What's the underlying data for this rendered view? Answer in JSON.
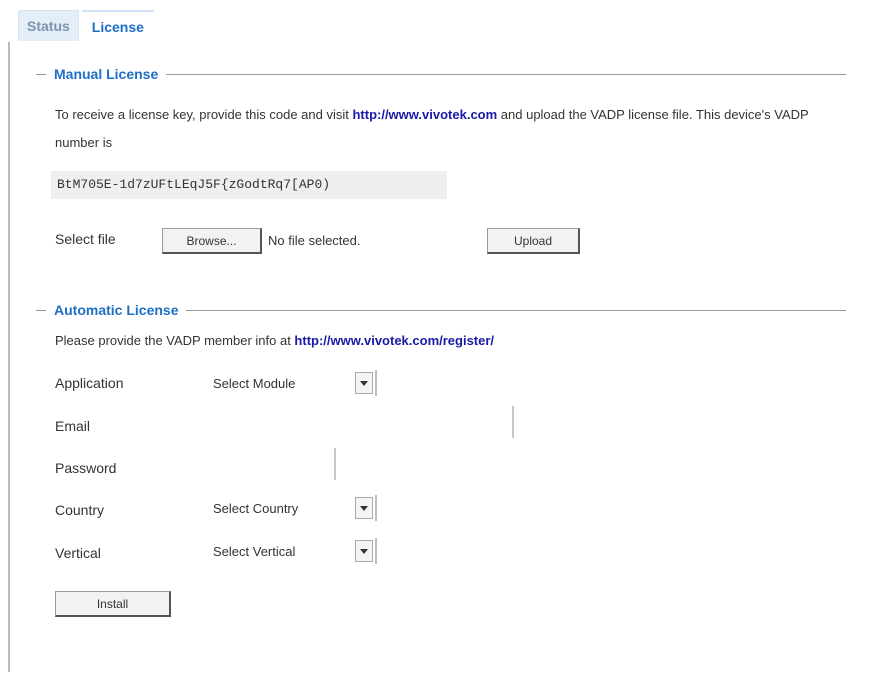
{
  "tabs": [
    {
      "label": "Status"
    },
    {
      "label": "License"
    }
  ],
  "manual": {
    "legend": "Manual License",
    "text_pre": "To receive a license key, provide this code and visit ",
    "link": "http://www.vivotek.com",
    "text_post": " and upload the VADP license file. This device's VADP number is",
    "code": "BtM705E-1d7zUFtLEqJ5F{zGodtRq7[AP0)",
    "select_file_label": "Select file",
    "browse_label": "Browse...",
    "no_file_label": "No file selected.",
    "upload_label": "Upload"
  },
  "automatic": {
    "legend": "Automatic License",
    "text_pre": "Please provide the VADP member info at ",
    "link": "http://www.vivotek.com/register/",
    "fields": {
      "application_label": "Application",
      "application_value": "Select Module",
      "email_label": "Email",
      "password_label": "Password",
      "country_label": "Country",
      "country_value": "Select Country",
      "vertical_label": "Vertical",
      "vertical_value": "Select Vertical"
    },
    "install_label": "Install"
  }
}
